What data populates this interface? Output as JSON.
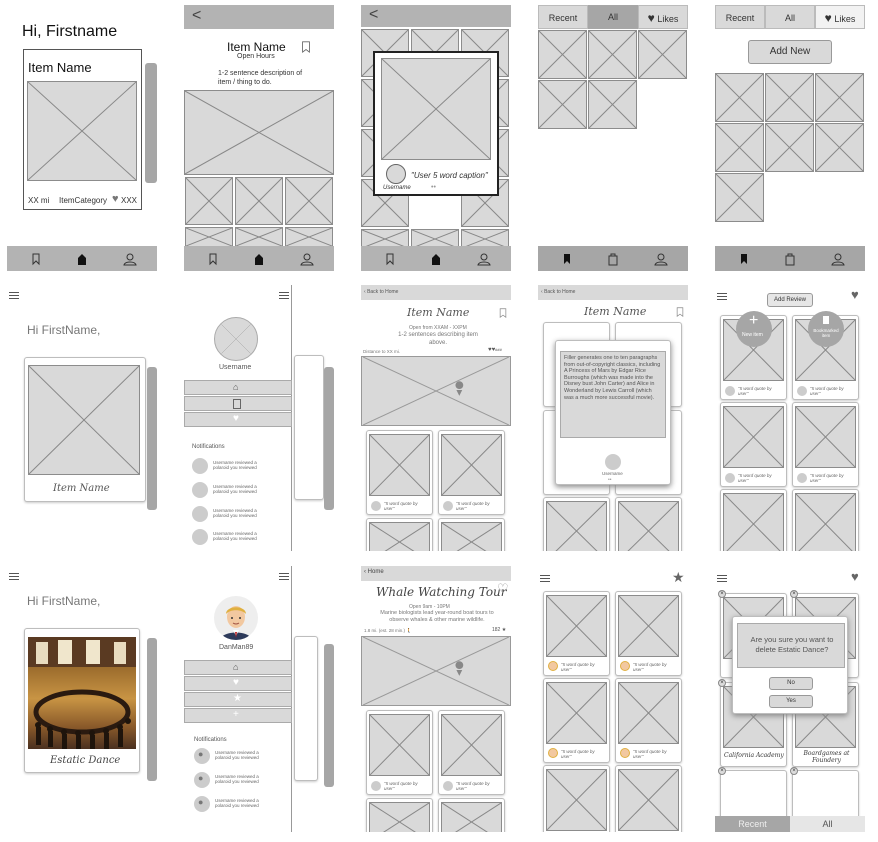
{
  "r1": {
    "s1": {
      "greeting": "Hi, Firstname",
      "item_name": "Item Name",
      "distance": "XX mi",
      "category": "ItemCategory",
      "likes": "XXX"
    },
    "s2": {
      "back": "<",
      "item_name": "Item Name",
      "hours": "Open Hours",
      "desc": "1-2 sentence description of item / thing to do."
    },
    "s3": {
      "back": "<",
      "caption": "\"User 5 word caption\"",
      "username": "Username"
    },
    "s4": {
      "tabs": [
        "Recent",
        "All",
        "Likes"
      ]
    },
    "s5": {
      "tabs": [
        "Recent",
        "All",
        "Likes"
      ],
      "add_new": "Add New"
    }
  },
  "r2": {
    "s1": {
      "greeting": "Hi FirstName,",
      "item_name": "Item Name"
    },
    "s2": {
      "username": "Username",
      "notifications": "Notifications",
      "notes": [
        "Username reviewed a polaroid you reviewed",
        "Username reviewed a polaroid you reviewed",
        "Username reviewed a polaroid you reviewed",
        "Username reviewed a polaroid you reviewed"
      ]
    },
    "s3": {
      "back": "Back to Home",
      "item_name": "Item Name",
      "hours": "Open from XXAM - XXPM",
      "desc": "1-2 sentences describing item above.",
      "distance": "Distance to XX mi.",
      "likes": "###",
      "quote": "\"5 word quote by user\""
    },
    "s4": {
      "back": "Back to Home",
      "item_name": "Item Name",
      "paragraph": "Filler generates one to ten paragraphs from out-of-copyright classics, including A Princess of Mars by Edgar Rice Burroughs (which was made into the Disney bust John Carter) and Alice in Wonderland by Lewis Carroll (which was a much more successful movie).",
      "username": "Username"
    },
    "s5": {
      "add_review": "Add Review",
      "new_item": "New item",
      "bookmarked": "Bookmarked item",
      "quote": "\"5 word quote by user\""
    }
  },
  "r3": {
    "s1": {
      "greeting": "Hi FirstName,",
      "item_name": "Estatic Dance"
    },
    "s2": {
      "username": "DanMan89",
      "notifications": "Notifications",
      "notes": [
        "Username reviewed a polaroid you reviewed",
        "Username reviewed a polaroid you reviewed",
        "Username reviewed a polaroid you reviewed"
      ]
    },
    "s3": {
      "back": "Home",
      "title": "Whale Watching Tour",
      "hours": "Open 9am - 10PM",
      "desc": "Marine biologists lead year-round boat tours to observe whales & other marine wildlife.",
      "distance": "1.8 mi. (est. 28 min.)",
      "likes": "182",
      "quote": "\"5 word quote by user\""
    },
    "s4": {
      "quote": "\"5 word quote by user\""
    },
    "s5": {
      "dialog": "Are you sure you want to delete Estatic Dance?",
      "no": "No",
      "yes": "Yes",
      "card1": "California Academy",
      "card2": "Boardgames at Foundery",
      "tabs": [
        "Recent",
        "All"
      ]
    }
  }
}
